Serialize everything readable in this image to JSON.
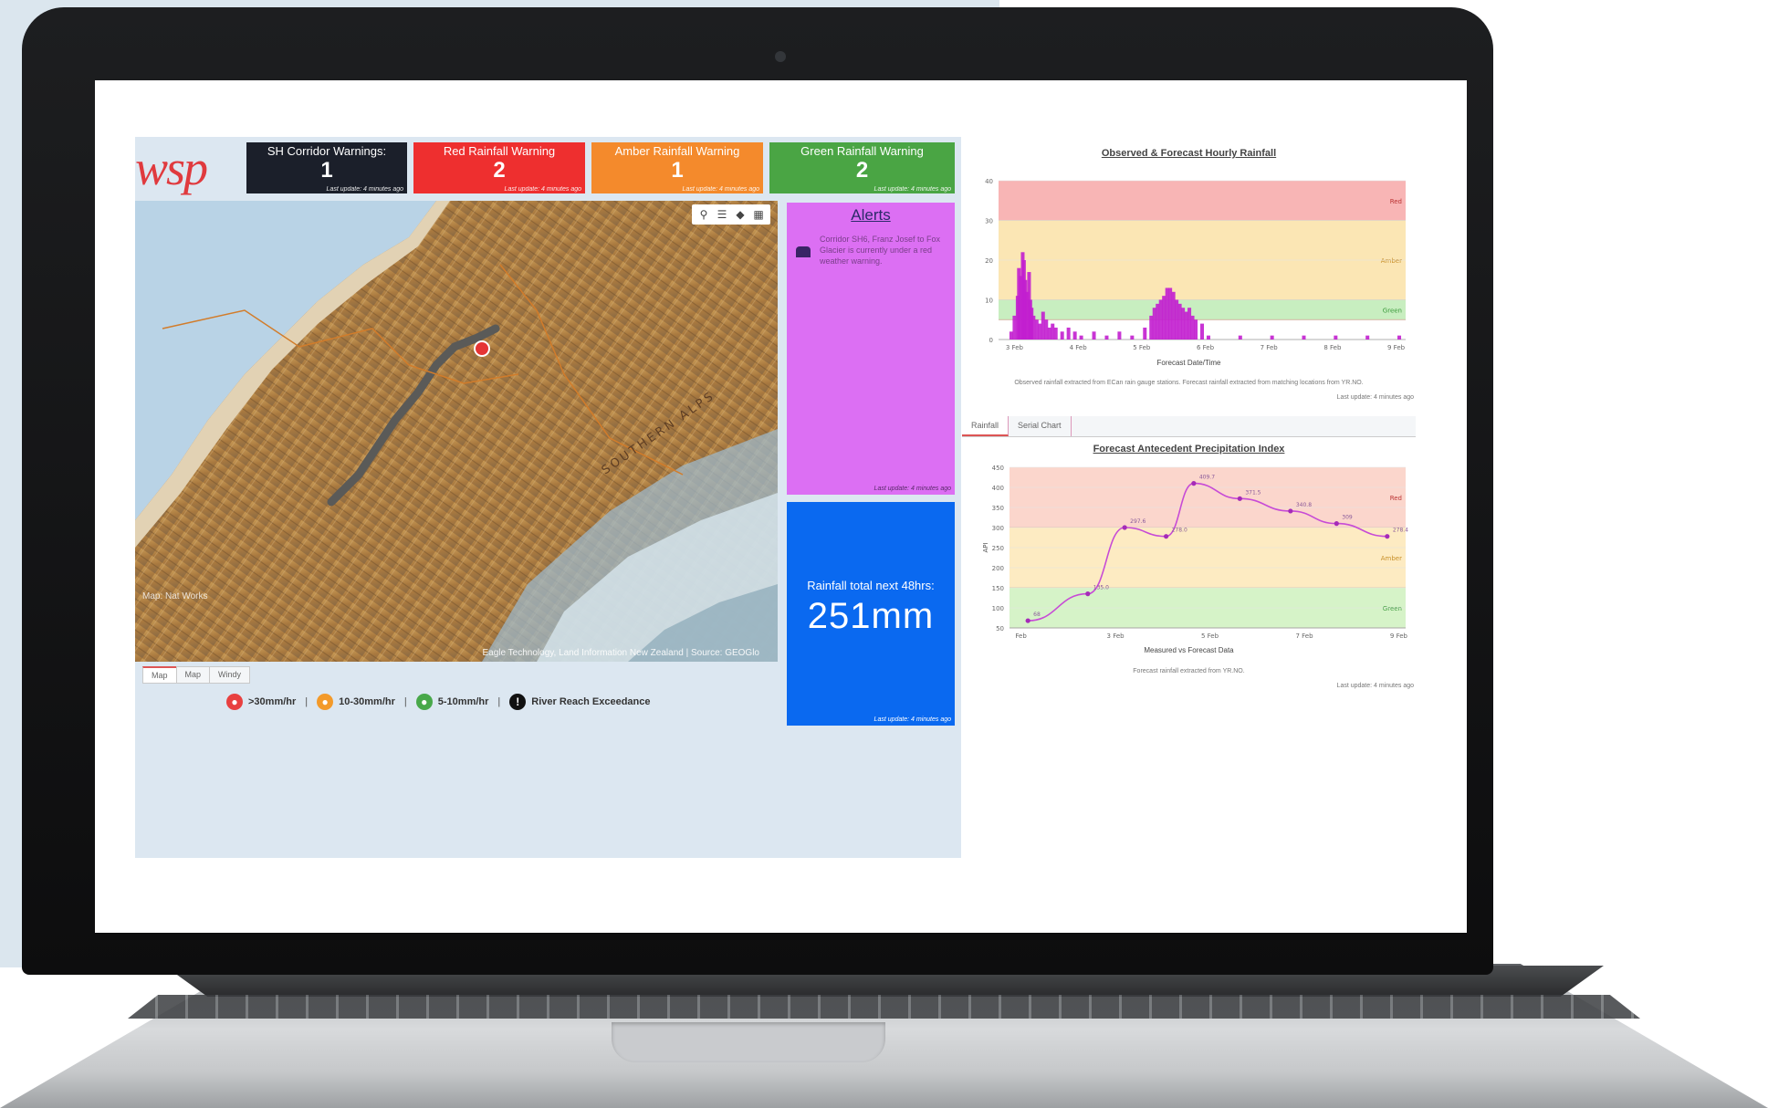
{
  "logo": {
    "text": "wsp"
  },
  "cards": [
    {
      "title": "SH Corridor Warnings:",
      "value": "1",
      "updated": "Last update: 4 minutes ago",
      "color": "#1b1f2a"
    },
    {
      "title": "Red Rainfall Warning",
      "value": "2",
      "updated": "Last update: 4 minutes ago",
      "color": "#ee2f2f"
    },
    {
      "title": "Amber Rainfall Warning",
      "value": "1",
      "updated": "Last update: 4 minutes ago",
      "color": "#f48a2c"
    },
    {
      "title": "Green Rainfall Warning",
      "value": "2",
      "updated": "Last update: 4 minutes ago",
      "color": "#4aa544"
    }
  ],
  "map": {
    "tools": [
      "search-icon",
      "list-icon",
      "layers-icon",
      "basemap-icon"
    ],
    "labels": {
      "southern_alps": "SOUTHERN ALPS",
      "left_corner": "Map: Nat Works"
    },
    "attribution": "Eagle Technology, Land Information New Zealand | Source: GEOGlo",
    "tabs": [
      "Map",
      "Map",
      "Windy"
    ]
  },
  "legend": {
    "items": [
      {
        "label": ">30mm/hr",
        "color": "#e84040"
      },
      {
        "label": "10-30mm/hr",
        "color": "#f39a2a"
      },
      {
        "label": "5-10mm/hr",
        "color": "#48a84a"
      },
      {
        "label": "River Reach Exceedance",
        "color": "#111111"
      }
    ],
    "separator": "|"
  },
  "alerts": {
    "title": "Alerts",
    "body": "Corridor SH6, Franz Josef to Fox Glacier is currently under a red weather warning.",
    "updated": "Last update: 4 minutes ago",
    "color": "#dc6ff3"
  },
  "rainfall": {
    "label": "Rainfall total next 48hrs:",
    "value": "251mm",
    "updated": "Last update: 4 minutes ago",
    "color": "#0a69f0"
  },
  "chart1_meta": {
    "footnote": "Observed rainfall extracted from ECan rain gauge stations. Forecast rainfall extracted from matching locations from YR.NO.",
    "updated": "Last update: 4 minutes ago",
    "tabs": [
      "Rainfall",
      "Serial Chart"
    ]
  },
  "chart2_meta": {
    "footnote": "Forecast rainfall extracted from YR.NO.",
    "updated": "Last update: 4 minutes ago"
  },
  "chart_data": [
    {
      "type": "bar",
      "title": "Observed & Forecast Hourly Rainfall",
      "xlabel": "Forecast Date/Time",
      "ylabel": "",
      "ylim": [
        0,
        40
      ],
      "yticks": [
        0,
        10,
        20,
        30,
        40
      ],
      "xticks": [
        "3 Feb",
        "4 Feb",
        "5 Feb",
        "6 Feb",
        "7 Feb",
        "8 Feb",
        "9 Feb"
      ],
      "xlim": [
        2.7,
        9.1
      ],
      "bands": [
        {
          "name": "Red",
          "from": 30,
          "to": 40,
          "color": "#f8b5b5"
        },
        {
          "name": "Amber",
          "from": 10,
          "to": 30,
          "color": "#fbe6b4"
        },
        {
          "name": "Green",
          "from": 5,
          "to": 10,
          "color": "#c8eec0"
        }
      ],
      "series": [
        {
          "color": "#c21ecf",
          "x": [
            2.9,
            2.95,
            3.0,
            3.02,
            3.05,
            3.08,
            3.1,
            3.12,
            3.15,
            3.18,
            3.2,
            3.22,
            3.25,
            3.3,
            3.35,
            3.4,
            3.45,
            3.5,
            3.55,
            3.6,
            3.7,
            3.8,
            3.9,
            4.0,
            4.2,
            4.4,
            4.6,
            4.8,
            5.0,
            5.1,
            5.15,
            5.2,
            5.25,
            5.3,
            5.35,
            5.4,
            5.45,
            5.5,
            5.55,
            5.6,
            5.65,
            5.7,
            5.75,
            5.8,
            5.9,
            6.0,
            6.5,
            7.0,
            7.5,
            8.0,
            8.5,
            9.0
          ],
          "values": [
            2,
            6,
            11,
            18,
            16,
            22,
            20,
            15,
            12,
            17,
            10,
            8,
            6,
            5,
            4,
            7,
            5,
            3,
            4,
            3,
            2,
            3,
            2,
            1,
            2,
            1,
            2,
            1,
            3,
            6,
            8,
            9,
            10,
            11,
            13,
            13,
            12,
            10,
            9,
            8,
            7,
            8,
            6,
            5,
            4,
            1,
            1,
            1,
            1,
            1,
            1,
            1
          ]
        }
      ]
    },
    {
      "type": "line",
      "title": "Forecast Antecedent Precipitation Index",
      "xlabel": "Measured vs Forecast Data",
      "ylabel": "API",
      "ylim": [
        50,
        450
      ],
      "yticks": [
        50,
        100,
        150,
        200,
        250,
        300,
        350,
        400,
        450
      ],
      "xticks": [
        "Feb",
        "3 Feb",
        "5 Feb",
        "7 Feb",
        "9 Feb"
      ],
      "bands": [
        {
          "name": "Red",
          "from": 300,
          "to": 450,
          "color": "#fbd6cc"
        },
        {
          "name": "Amber",
          "from": 150,
          "to": 300,
          "color": "#fdebc2"
        },
        {
          "name": "Green",
          "from": 50,
          "to": 150,
          "color": "#d6f3c8"
        }
      ],
      "series": [
        {
          "color": "#c74bd6",
          "x": [
            1.0,
            2.3,
            3.1,
            4.0,
            4.6,
            5.6,
            6.7,
            7.7,
            8.8
          ],
          "values": [
            68,
            135,
            300,
            278,
            410,
            372,
            341,
            310,
            278
          ],
          "labels": [
            "68",
            "135.0",
            "297.6",
            "278.0",
            "409.7",
            "371.5",
            "340.8",
            "309",
            "278.4"
          ]
        }
      ],
      "xlim": [
        0.6,
        9.2
      ]
    }
  ]
}
